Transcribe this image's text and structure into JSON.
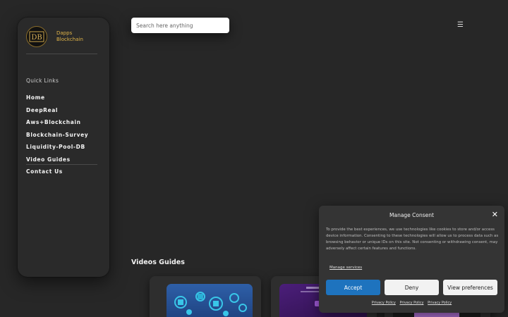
{
  "brand": {
    "line1": "Dapps",
    "line2": "Blockchain",
    "logo_letters": "DB"
  },
  "sidebar": {
    "quick_links": "Quick Links",
    "items": [
      {
        "label": "Home"
      },
      {
        "label": "DeepReal"
      },
      {
        "label": "Aws+Blockchain"
      },
      {
        "label": "Blockchain-Survey"
      },
      {
        "label": "Liquidity-Pool-DB"
      },
      {
        "label": "Video Guides"
      },
      {
        "label": "Contact Us"
      }
    ]
  },
  "search": {
    "placeholder": "Search here anything"
  },
  "menu_icon": "☰",
  "videos": {
    "title": "Videos Guides"
  },
  "consent": {
    "title": "Manage Consent",
    "close": "✕",
    "body": "To provide the best experiences, we use technologies like cookies to store and/or access device information. Consenting to these technologies will allow us to process data such as browsing behavior or unique IDs on this site. Not consenting or withdrawing consent, may adversely affect certain features and functions.",
    "manage_services": "Manage services",
    "accept": "Accept",
    "deny": "Deny",
    "preferences": "View preferences",
    "policy_links": [
      "Privacy Policy",
      "Privacy Policy",
      "Privacy Policy"
    ]
  },
  "colors": {
    "accent": "#1e73be",
    "brand_gold": "#e0b448",
    "background": "#272727"
  }
}
